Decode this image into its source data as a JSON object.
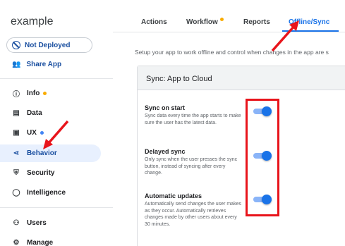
{
  "app": {
    "name": "example"
  },
  "sidebar": {
    "deploy_status": "Not Deployed",
    "share_label": "Share App",
    "items": [
      {
        "label": "Info",
        "icon": "info-icon",
        "dot": "#f9ab00"
      },
      {
        "label": "Data",
        "icon": "database-icon"
      },
      {
        "label": "UX",
        "icon": "ux-icon",
        "dot": "#4285f4"
      },
      {
        "label": "Behavior",
        "icon": "behavior-icon",
        "active": true
      },
      {
        "label": "Security",
        "icon": "shield-icon"
      },
      {
        "label": "Intelligence",
        "icon": "lightbulb-icon"
      },
      {
        "label": "Users",
        "icon": "users-icon"
      },
      {
        "label": "Manage",
        "icon": "manage-icon"
      }
    ]
  },
  "tabs": [
    {
      "label": "Actions"
    },
    {
      "label": "Workflow",
      "dot": "#f9ab00"
    },
    {
      "label": "Reports"
    },
    {
      "label": "Offline/Sync",
      "active": true
    }
  ],
  "main": {
    "subtitle": "Setup your app to work offline and control when changes in the app are s",
    "card_title": "Sync: App to Cloud",
    "settings": [
      {
        "name": "Sync on start",
        "desc": "Sync data every time the app starts to make sure the user has the latest data.",
        "enabled": true
      },
      {
        "name": "Delayed sync",
        "desc": "Only sync when the user presses the sync button, instead of syncing after every change.",
        "enabled": true
      },
      {
        "name": "Automatic updates",
        "desc": "Automatically send changes the user makes as they occur. Automatically retrieves changes made by other users about every 30 minutes.",
        "enabled": true
      }
    ]
  },
  "colors": {
    "accent": "#1a73e8",
    "annotation": "#e8141b"
  }
}
